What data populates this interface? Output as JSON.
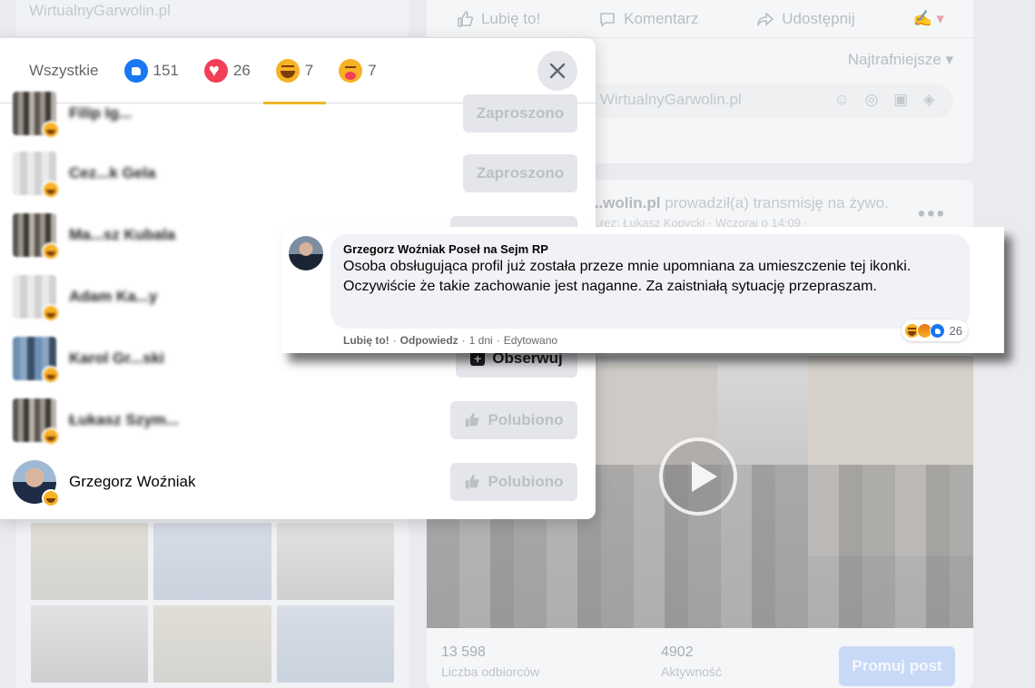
{
  "background": {
    "page_name": "WirtualnyGarwolin.pl",
    "actions": {
      "like": "Lubię to!",
      "comment": "Komentarz",
      "share": "Udostępnij"
    },
    "sort": "Najtrafniejsze",
    "comment_placeholder": "...zo WirtualnyGarwolin.pl",
    "post": {
      "author": "...wolin.pl",
      "author_suffix": "prowadził(a) transmisję na żywo.",
      "meta": "...rez: Łukasz Kopycki · Wczoraj o 14:09 ·"
    },
    "stats": [
      {
        "value": "13 598",
        "label": "Liczba odbiorców"
      },
      {
        "value": "4902",
        "label": "Aktywność"
      }
    ],
    "promote_label": "Promuj post"
  },
  "modal": {
    "tabs": [
      {
        "label": "Wszystkie"
      },
      {
        "emoji": "like-icon",
        "count": "151"
      },
      {
        "emoji": "love-icon",
        "count": "26"
      },
      {
        "emoji": "haha-icon",
        "count": "7"
      },
      {
        "emoji": "care-icon",
        "count": "7"
      }
    ],
    "rows": [
      {
        "name": "Filip Ig...",
        "button": "Zaproszono"
      },
      {
        "name": "Cez...k Gela",
        "button": "Zaproszono"
      },
      {
        "name": "Ma...sz Kubala",
        "button": ""
      },
      {
        "name": "Adam Ka...y",
        "button": ""
      },
      {
        "name": "Karol Gr...ski",
        "button": "Obserwuj"
      },
      {
        "name": "Łukasz Szym...",
        "button": "Polubiono"
      },
      {
        "name": "Grzegorz Woźniak",
        "button": "Polubiono"
      }
    ]
  },
  "comment": {
    "author": "Grzegorz Woźniak Poseł na Sejm RP",
    "text": "Osoba obsługująca profil już została przeze mnie upomniana za umieszczenie tej ikonki. Oczywiście że takie zachowanie jest naganne. Za zaistniałą sytuację przepraszam.",
    "like_label": "Lubię to!",
    "reply_label": "Odpowiedz",
    "time": "1 dni",
    "edited": "Edytowano",
    "reaction_count": "26"
  },
  "colors": {
    "accent": "#1877f2",
    "haha": "#f0b628",
    "love": "#f33e58"
  }
}
